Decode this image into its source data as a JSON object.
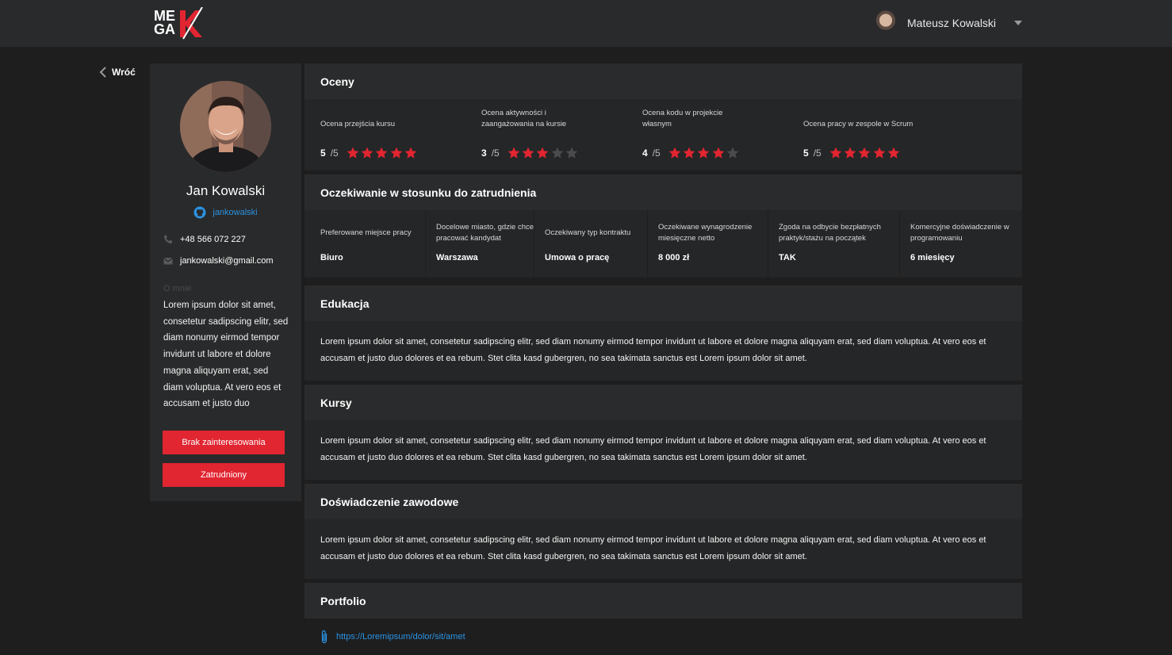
{
  "header": {
    "logo_line1": "ME",
    "logo_line2": "GA",
    "user_name": "Mateusz Kowalski"
  },
  "back_label": "Wróć",
  "profile": {
    "name": "Jan Kowalski",
    "github": "jankowalski",
    "phone": "+48 566 072 227",
    "email": "jankowalski@gmail.com",
    "about_heading": "O mnie",
    "about_text": "Lorem ipsum dolor sit amet, consetetur sadipscing elitr, sed diam nonumy eirmod tempor invidunt ut labore et dolore magna aliquyam erat, sed diam voluptua. At vero eos et accusam et justo duo",
    "btn_no_interest": "Brak zainteresowania",
    "btn_hired": "Zatrudniony"
  },
  "ratings": {
    "title": "Oceny",
    "items": [
      {
        "label": "Ocena przejścia kursu",
        "score": "5",
        "of": "/5",
        "value": 5
      },
      {
        "label": "Ocena aktywności i zaangażowania na kursie",
        "score": "3",
        "of": "/5",
        "value": 3
      },
      {
        "label": "Ocena kodu w projekcie własnym",
        "score": "4",
        "of": "/5",
        "value": 4
      },
      {
        "label": "Ocena pracy w zespole w Scrum",
        "score": "5",
        "of": "/5",
        "value": 5
      }
    ],
    "star_color_on": "#e12531",
    "star_color_off": "#4b4b4d"
  },
  "expectations": {
    "title": "Oczekiwanie w stosunku do zatrudnienia",
    "items": [
      {
        "label": "Preferowane miejsce pracy",
        "value": "Biuro"
      },
      {
        "label": "Docelowe miasto, gdzie chce pracować kandydat",
        "value": "Warszawa"
      },
      {
        "label": "Oczekiwany typ kontraktu",
        "value": "Umowa o pracę"
      },
      {
        "label": "Oczekiwane wynagrodzenie miesięczne netto",
        "value": "8 000 zł"
      },
      {
        "label": "Zgoda na odbycie bezpłatnych praktyk/stażu na początek",
        "value": "TAK"
      },
      {
        "label": "Komercyjne doświadczenie w programowaniu",
        "value": "6 miesięcy"
      }
    ]
  },
  "education": {
    "title": "Edukacja",
    "text": "Lorem ipsum dolor sit amet, consetetur sadipscing elitr, sed diam nonumy eirmod tempor invidunt ut labore et dolore magna aliquyam erat, sed diam voluptua. At vero eos et accusam et justo duo dolores et ea rebum. Stet clita kasd gubergren, no sea takimata sanctus est Lorem ipsum dolor sit amet."
  },
  "courses": {
    "title": "Kursy",
    "text": "Lorem ipsum dolor sit amet, consetetur sadipscing elitr, sed diam nonumy eirmod tempor invidunt ut labore et dolore magna aliquyam erat, sed diam voluptua. At vero eos et accusam et justo duo dolores et ea rebum. Stet clita kasd gubergren, no sea takimata sanctus est Lorem ipsum dolor sit amet."
  },
  "experience": {
    "title": "Doświadczenie zawodowe",
    "text": "Lorem ipsum dolor sit amet, consetetur sadipscing elitr, sed diam nonumy eirmod tempor invidunt ut labore et dolore magna aliquyam erat, sed diam voluptua. At vero eos et accusam et justo duo dolores et ea rebum. Stet clita kasd gubergren, no sea takimata sanctus est Lorem ipsum dolor sit amet."
  },
  "portfolio": {
    "title": "Portfolio",
    "link": "https://Loremipsum/dolor/sit/amet"
  },
  "icons": {
    "back": "chevron-left-icon",
    "caret": "caret-down-icon",
    "github": "github-icon",
    "phone": "phone-icon",
    "email": "envelope-icon",
    "star": "star-icon",
    "attachment": "paperclip-icon"
  }
}
